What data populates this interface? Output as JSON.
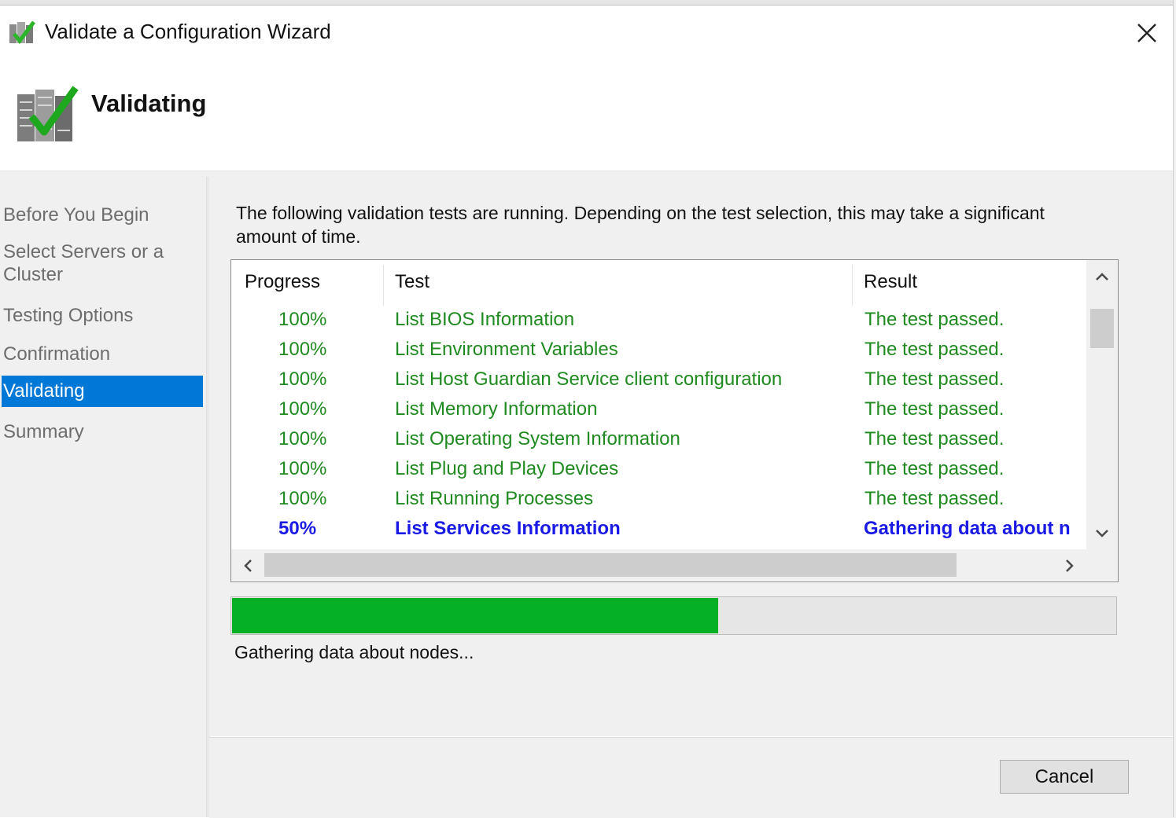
{
  "window": {
    "title": "Validate a Configuration Wizard",
    "close_icon": "close-icon",
    "app_icon": "cluster-validate-icon"
  },
  "header": {
    "title": "Validating",
    "icon": "servers-checkmark-icon"
  },
  "steps": [
    {
      "label": "Before You Begin",
      "active": false
    },
    {
      "label": "Select Servers or a Cluster",
      "active": false
    },
    {
      "label": "Testing Options",
      "active": false
    },
    {
      "label": "Confirmation",
      "active": false
    },
    {
      "label": "Validating",
      "active": true
    },
    {
      "label": "Summary",
      "active": false
    }
  ],
  "intro": "The following validation tests are running. Depending on the test selection, this may take a significant amount of time.",
  "table": {
    "columns": [
      "Progress",
      "Test",
      "Result"
    ],
    "rows": [
      {
        "progress": "100%",
        "test": "List BIOS Information",
        "result": "The test passed.",
        "state": "done"
      },
      {
        "progress": "100%",
        "test": "List Environment Variables",
        "result": "The test passed.",
        "state": "done"
      },
      {
        "progress": "100%",
        "test": "List Host Guardian Service client configuration",
        "result": "The test passed.",
        "state": "done"
      },
      {
        "progress": "100%",
        "test": "List Memory Information",
        "result": "The test passed.",
        "state": "done"
      },
      {
        "progress": "100%",
        "test": "List Operating System Information",
        "result": "The test passed.",
        "state": "done"
      },
      {
        "progress": "100%",
        "test": "List Plug and Play Devices",
        "result": "The test passed.",
        "state": "done"
      },
      {
        "progress": "100%",
        "test": "List Running Processes",
        "result": "The test passed.",
        "state": "done"
      },
      {
        "progress": "50%",
        "test": "List Services Information",
        "result": "Gathering data about n",
        "state": "running"
      }
    ]
  },
  "progress": {
    "fraction": 0.55,
    "status": "Gathering data about nodes..."
  },
  "buttons": {
    "cancel": "Cancel"
  },
  "colors": {
    "accent": "#0078d7",
    "passed": "#1f8a1f",
    "running": "#1a1ae6",
    "progress_fill": "#06b025"
  }
}
